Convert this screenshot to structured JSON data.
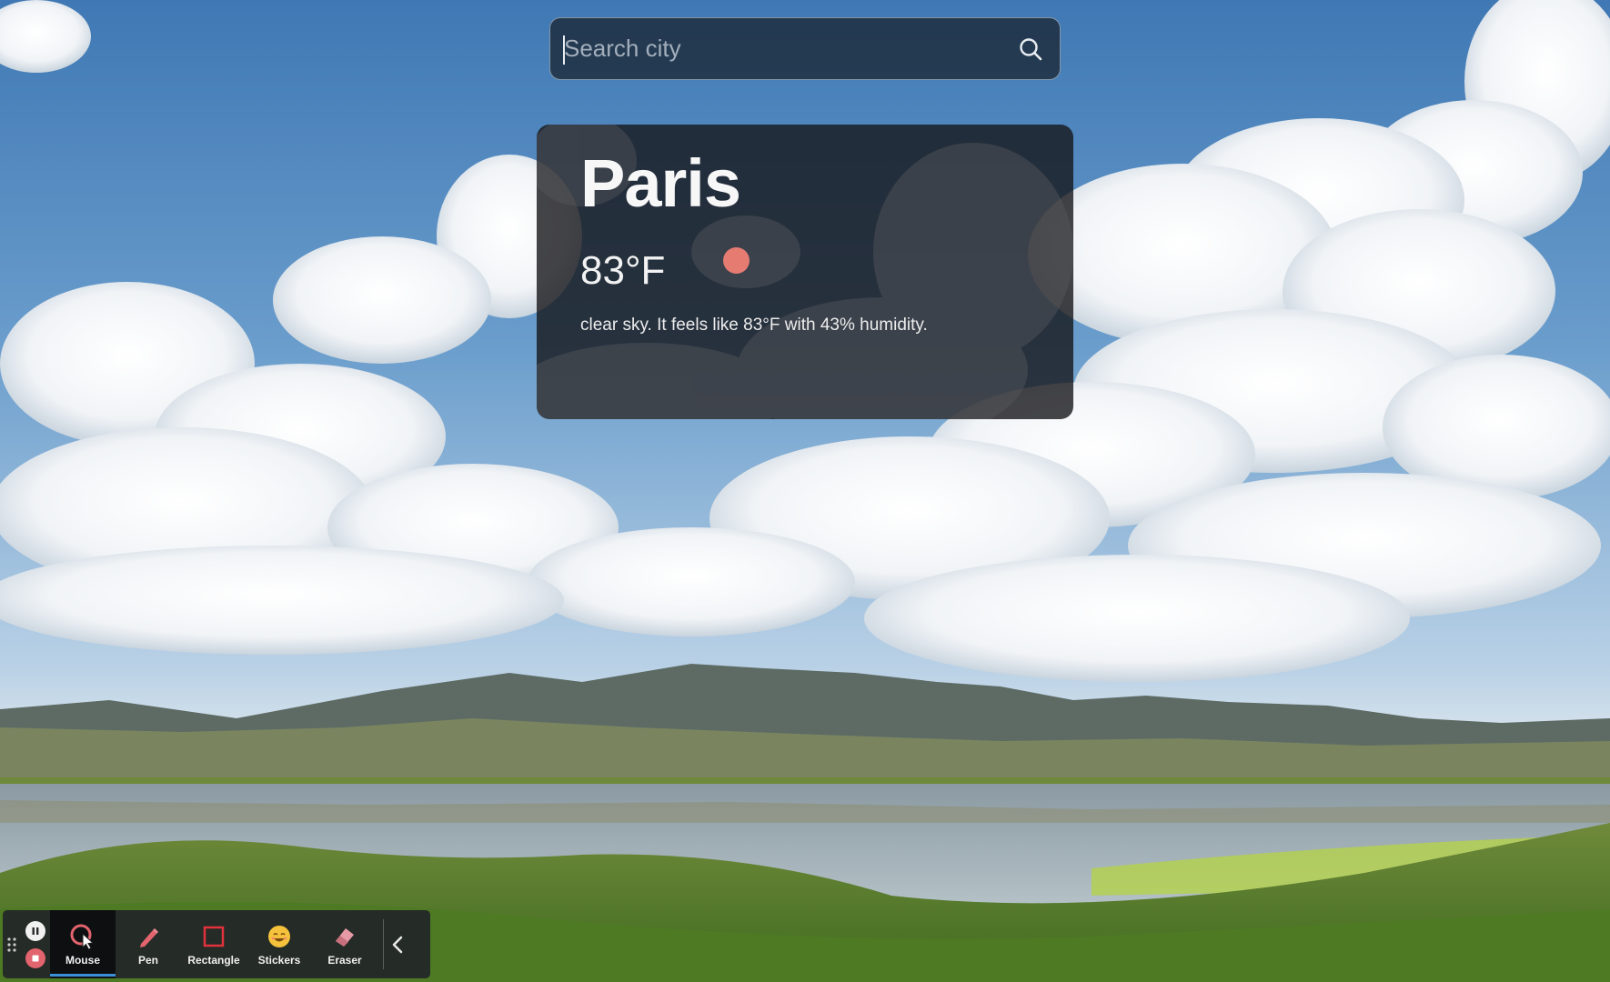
{
  "search": {
    "placeholder": "Search city",
    "value": ""
  },
  "weather": {
    "city": "Paris",
    "temperature": "83°F",
    "description": "clear sky. It feels like 83°F with 43% humidity."
  },
  "toolbar": {
    "tools": [
      {
        "label": "Mouse",
        "icon": "mouse-cursor-icon",
        "active": true
      },
      {
        "label": "Pen",
        "icon": "pen-icon",
        "active": false
      },
      {
        "label": "Rectangle",
        "icon": "rectangle-icon",
        "active": false
      },
      {
        "label": "Stickers",
        "icon": "sticker-smiley-icon",
        "active": false
      },
      {
        "label": "Eraser",
        "icon": "eraser-icon",
        "active": false
      }
    ],
    "controls": [
      "drag-grip-icon",
      "pause-icon",
      "stop-icon",
      "chevron-left-icon"
    ]
  },
  "colors": {
    "card": "#16161a",
    "sun_marker": "#e67b72",
    "active_tool_underline": "#3b8fd8",
    "stop_button": "#e2646e"
  }
}
